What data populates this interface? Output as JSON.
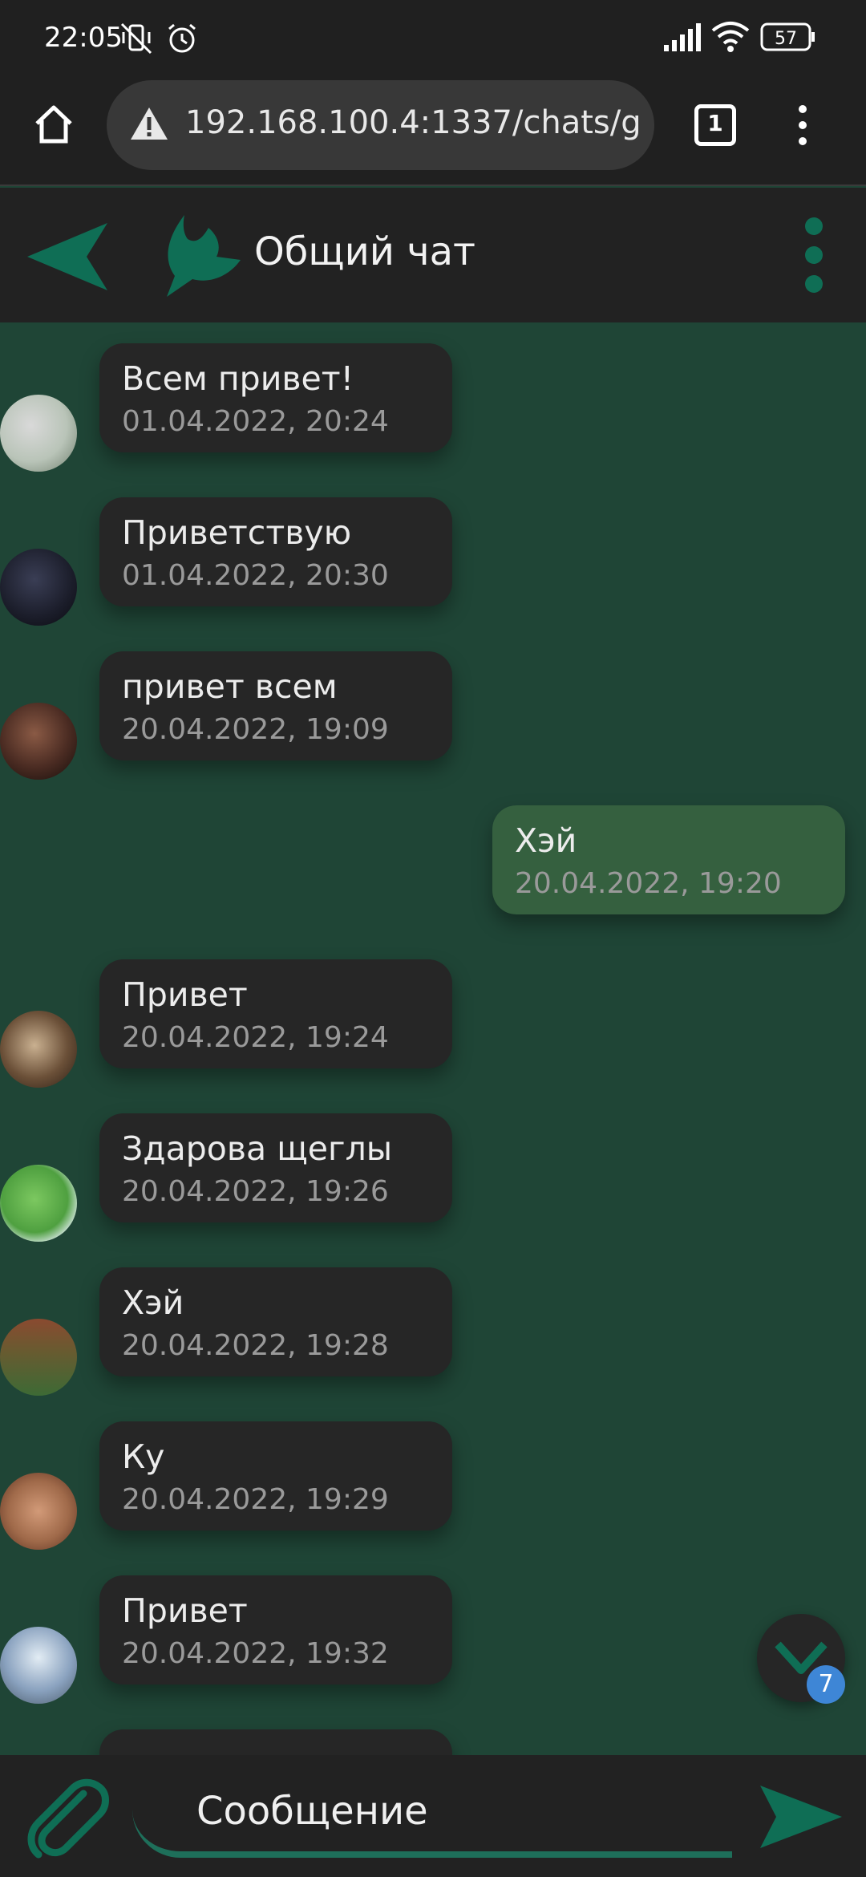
{
  "status_bar": {
    "time": "22:05",
    "battery": "57"
  },
  "browser": {
    "url": "192.168.100.4:1337/chats/g",
    "tab_count": "1"
  },
  "header": {
    "title": "Общий чат"
  },
  "messages": [
    {
      "text": "Всем привет!",
      "time": "01.04.2022, 20:24",
      "own": false,
      "avatar_color": "#b9c4b8"
    },
    {
      "text": "Приветствую",
      "time": "01.04.2022, 20:30",
      "own": false,
      "avatar_color": "#1b1d2a"
    },
    {
      "text": "привет всем",
      "time": "20.04.2022, 19:09",
      "own": false,
      "avatar_color": "#4a2b22"
    },
    {
      "text": "Хэй",
      "time": "20.04.2022, 19:20",
      "own": true
    },
    {
      "text": "Привет",
      "time": "20.04.2022, 19:24",
      "own": false,
      "avatar_color": "#6b5038"
    },
    {
      "text": "Здарова щеглы",
      "time": "20.04.2022, 19:26",
      "own": false,
      "avatar_color": "#4fa040"
    },
    {
      "text": "Хэй",
      "time": "20.04.2022, 19:28",
      "own": false,
      "avatar_color": "#6a5a30"
    },
    {
      "text": "Ку",
      "time": "20.04.2022, 19:29",
      "own": false,
      "avatar_color": "#a06a4a"
    },
    {
      "text": "Привет",
      "time": "20.04.2022, 19:32",
      "own": false,
      "avatar_color": "#8aa2bf"
    }
  ],
  "scroll_fab": {
    "badge": "7"
  },
  "composer": {
    "placeholder": "Сообщение"
  },
  "colors": {
    "accent": "#0f6e55",
    "background": "#1f4536",
    "bubble": "#262626",
    "own_bubble": "#35603f",
    "panel": "#222222"
  }
}
